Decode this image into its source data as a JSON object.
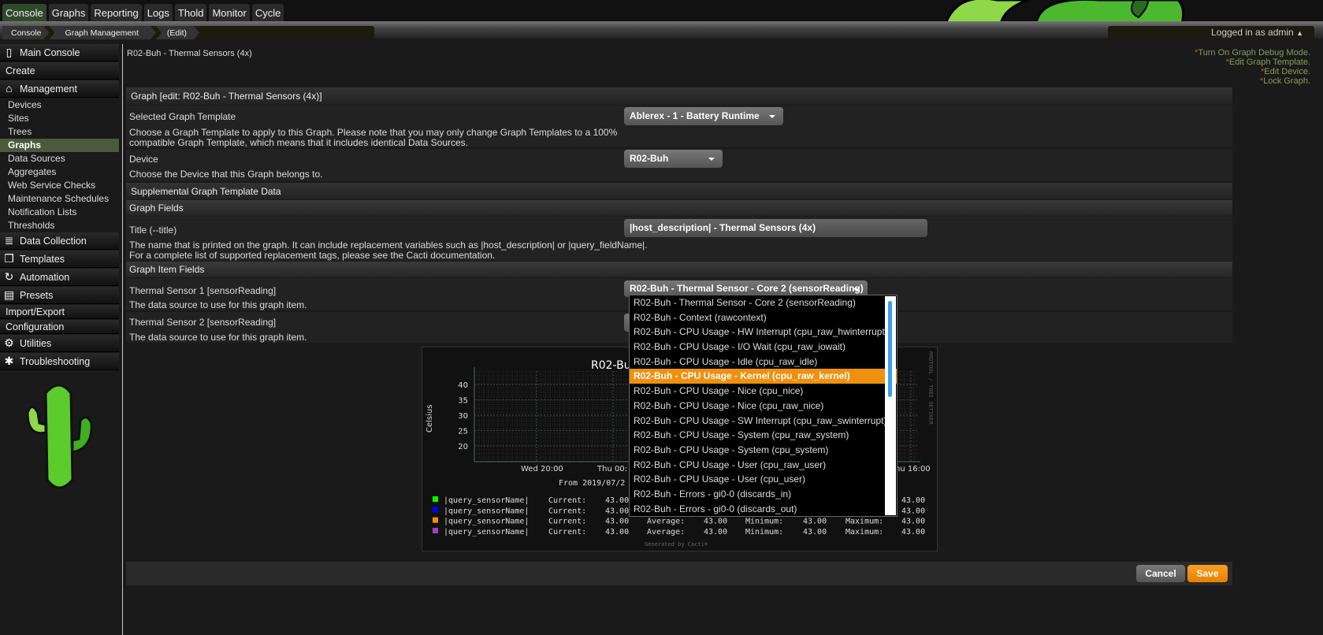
{
  "nav": {
    "tabs": [
      "Console",
      "Graphs",
      "Reporting",
      "Logs",
      "Thold",
      "Monitor",
      "Cycle"
    ],
    "active": "Console"
  },
  "breadcrumb": [
    "Console",
    "Graph Management",
    "(Edit)"
  ],
  "login": "Logged in as admin",
  "sidebar": {
    "main_console": "Main Console",
    "create": "Create",
    "management": "Management",
    "management_items": [
      "Devices",
      "Sites",
      "Trees",
      "Graphs",
      "Data Sources",
      "Aggregates",
      "Web Service Checks",
      "Maintenance Schedules",
      "Notification Lists",
      "Thresholds"
    ],
    "active": "Graphs",
    "data_collection": "Data Collection",
    "templates": "Templates",
    "automation": "Automation",
    "presets": "Presets",
    "import_export": "Import/Export",
    "configuration": "Configuration",
    "utilities": "Utilities",
    "troubleshooting": "Troubleshooting"
  },
  "page": {
    "title": "R02-Buh - Thermal Sensors (4x)",
    "links": [
      "Turn On Graph Debug Mode.",
      "Edit Graph Template.",
      "Edit Device.",
      "Lock Graph."
    ],
    "section_header": "Graph [edit: R02-Buh - Thermal Sensors (4x)]",
    "template_label": "Selected Graph Template",
    "template_value": "Ablerex - 1 - Battery Runtime",
    "template_desc": "Choose a Graph Template to apply to this Graph. Please note that you may only change Graph Templates to a 100% compatible Graph Template, which means that it includes identical Data Sources.",
    "device_label": "Device",
    "device_value": "R02-Buh",
    "device_desc": "Choose the Device that this Graph belongs to.",
    "supplemental": "Supplemental Graph Template Data",
    "graph_fields": "Graph Fields",
    "title_label": "Title (--title)",
    "title_value": "|host_description| - Thermal Sensors (4x)",
    "title_desc1": "The name that is printed on the graph. It can include replacement variables such as |host_description| or |query_fieldName|.",
    "title_desc2": "For a complete list of supported replacement tags, please see the Cacti documentation.",
    "graph_item_fields": "Graph Item Fields",
    "sensor1_label": "Thermal Sensor 1 [sensorReading]",
    "sensor1_value": "R02-Buh - Thermal Sensor - Core 2 (sensorReading)",
    "sensor1_desc": "The data source to use for this graph item.",
    "sensor2_label": "Thermal Sensor 2 [sensorReading]",
    "sensor2_desc": "The data source to use for this graph item."
  },
  "dropdown": {
    "options": [
      "R02-Buh - Thermal Sensor - Core 2 (sensorReading)",
      "R02-Buh - Context (rawcontext)",
      "R02-Buh - CPU Usage - HW Interrupt (cpu_raw_hwinterrupt)",
      "R02-Buh - CPU Usage - I/O Wait (cpu_raw_iowait)",
      "R02-Buh - CPU Usage - Idle (cpu_raw_idle)",
      "R02-Buh - CPU Usage - Kernel (cpu_raw_kernel)",
      "R02-Buh - CPU Usage - Nice (cpu_nice)",
      "R02-Buh - CPU Usage - Nice (cpu_raw_nice)",
      "R02-Buh - CPU Usage - SW Interrupt (cpu_raw_swinterrupt)",
      "R02-Buh - CPU Usage - System (cpu_raw_system)",
      "R02-Buh - CPU Usage - System (cpu_system)",
      "R02-Buh - CPU Usage - User (cpu_raw_user)",
      "R02-Buh - CPU Usage - User (cpu_user)",
      "R02-Buh - Errors - gi0-0 (discards_in)",
      "R02-Buh - Errors - gi0-0 (discards_out)"
    ],
    "highlighted": 5,
    "highlight_color": "#f0900f"
  },
  "graph": {
    "title": "R02-Bu",
    "ylabel": "Celsius",
    "yticks": [
      "40",
      "35",
      "30",
      "25",
      "20"
    ],
    "xticks": [
      "Wed 20:00",
      "Thu 00:",
      "hu 16:00"
    ],
    "from": "From 2019/07/2",
    "watermark": "RRDTOOL / TOBI OETIKER",
    "generated": "Generated by Cacti®",
    "legend": [
      {
        "name": "|query_sensorName|",
        "color": "#00ff00",
        "current": "43.00",
        "average": "43.00",
        "minimum": "43.00",
        "maximum": "43.00"
      },
      {
        "name": "|query_sensorName|",
        "color": "#0000ff",
        "current": "43.00",
        "average": "43.00",
        "minimum": "43.00",
        "maximum": "43.00"
      },
      {
        "name": "|query_sensorName|",
        "color": "#ff8c00",
        "current": "43.00",
        "average": "43.00",
        "minimum": "43.00",
        "maximum": "43.00"
      },
      {
        "name": "|query_sensorName|",
        "color": "#a040c0",
        "current": "43.00",
        "average": "43.00",
        "minimum": "43.00",
        "maximum": "43.00"
      }
    ],
    "labels": {
      "current": "Current:",
      "average": "Average:",
      "minimum": "Minimum:",
      "maximum": "Maximum:"
    }
  },
  "buttons": {
    "cancel": "Cancel",
    "save": "Save"
  }
}
